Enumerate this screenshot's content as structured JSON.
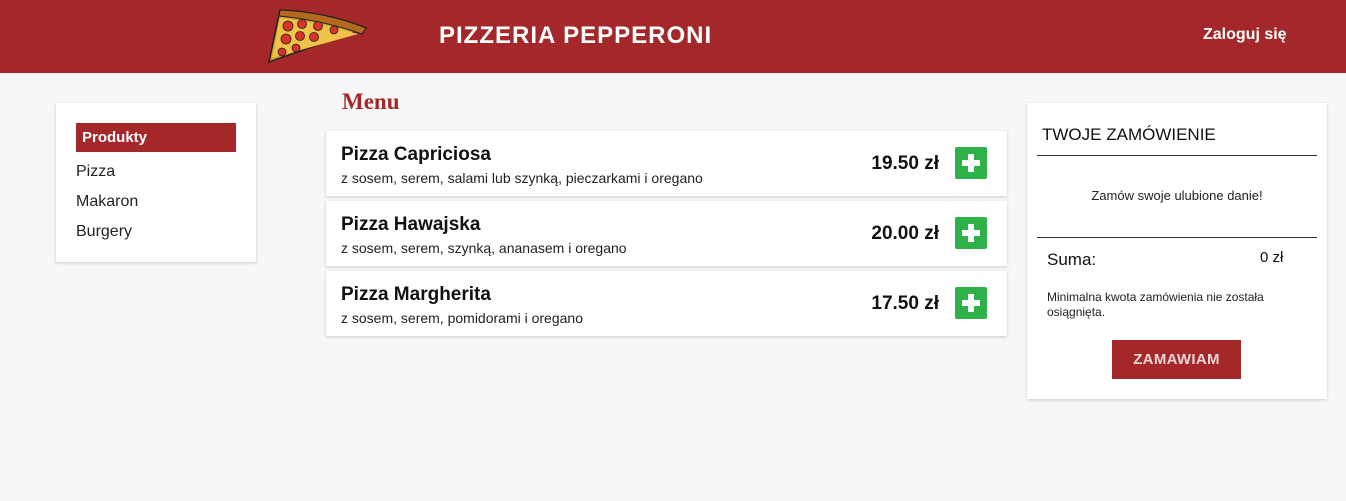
{
  "header": {
    "brand": "PIZZERIA PEPPERONI",
    "login": "Zaloguj się",
    "background": "#a4282a"
  },
  "sidebar": {
    "heading": "Produkty",
    "items": [
      {
        "label": "Pizza"
      },
      {
        "label": "Makaron"
      },
      {
        "label": "Burgery"
      }
    ]
  },
  "menu": {
    "title": "Menu",
    "items": [
      {
        "name": "Pizza Capriciosa",
        "description": "z sosem, serem, salami lub szynką, pieczarkami i oregano",
        "price": "19.50 zł"
      },
      {
        "name": "Pizza Hawajska",
        "description": "z sosem, serem, szynką, ananasem i oregano",
        "price": "20.00 zł"
      },
      {
        "name": "Pizza Margherita",
        "description": "z sosem, serem, pomidorami i oregano",
        "price": "17.50 zł"
      }
    ],
    "add_icon": "plus-icon",
    "add_color": "#2fb14a"
  },
  "order": {
    "title": "TWOJE ZAMÓWIENIE",
    "empty_message": "Zamów swoje ulubione danie!",
    "sum_label": "Suma:",
    "sum_value": "0 zł",
    "min_note": "Minimalna kwota zamówienia nie została osiągnięta.",
    "button": "ZAMAWIAM"
  }
}
